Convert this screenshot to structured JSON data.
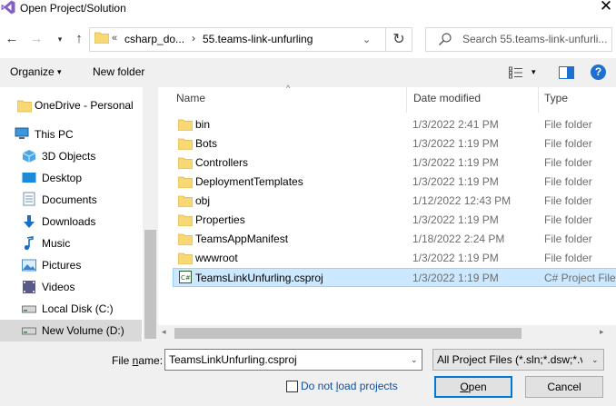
{
  "window": {
    "title": "Open Project/Solution",
    "close_glyph": "✕"
  },
  "nav": {
    "back_glyph": "←",
    "forward_glyph": "→",
    "recent_glyph": "▾",
    "up_glyph": "↑",
    "address": {
      "chevrons": "«",
      "segment1": "csharp_do...",
      "separator": "›",
      "segment2": "55.teams-link-unfurling",
      "dropdown_glyph": "⌄"
    },
    "refresh_glyph": "↻",
    "search_placeholder": "Search 55.teams-link-unfurli..."
  },
  "toolbar": {
    "organize_label": "Organize",
    "organize_caret": "▾",
    "new_folder_label": "New folder",
    "view_caret": "▾",
    "help_glyph": "?"
  },
  "sidebar": {
    "items": [
      {
        "label": "OneDrive - Personal",
        "icon": "folder-icon"
      },
      {
        "label": "This PC",
        "icon": "pc-icon"
      },
      {
        "label": "3D Objects",
        "icon": "cube-icon"
      },
      {
        "label": "Desktop",
        "icon": "desktop-icon"
      },
      {
        "label": "Documents",
        "icon": "documents-icon"
      },
      {
        "label": "Downloads",
        "icon": "download-icon"
      },
      {
        "label": "Music",
        "icon": "music-icon"
      },
      {
        "label": "Pictures",
        "icon": "pictures-icon"
      },
      {
        "label": "Videos",
        "icon": "videos-icon"
      },
      {
        "label": "Local Disk (C:)",
        "icon": "drive-icon"
      },
      {
        "label": "New Volume (D:)",
        "icon": "drive-icon"
      }
    ]
  },
  "filelist": {
    "columns": {
      "name": "Name",
      "date": "Date modified",
      "type": "Type"
    },
    "sort_glyph": "^",
    "rows": [
      {
        "name": "bin",
        "date": "1/3/2022 2:41 PM",
        "type": "File folder"
      },
      {
        "name": "Bots",
        "date": "1/3/2022 1:19 PM",
        "type": "File folder"
      },
      {
        "name": "Controllers",
        "date": "1/3/2022 1:19 PM",
        "type": "File folder"
      },
      {
        "name": "DeploymentTemplates",
        "date": "1/3/2022 1:19 PM",
        "type": "File folder"
      },
      {
        "name": "obj",
        "date": "1/12/2022 12:43 PM",
        "type": "File folder"
      },
      {
        "name": "Properties",
        "date": "1/3/2022 1:19 PM",
        "type": "File folder"
      },
      {
        "name": "TeamsAppManifest",
        "date": "1/18/2022 2:24 PM",
        "type": "File folder"
      },
      {
        "name": "wwwroot",
        "date": "1/3/2022 1:19 PM",
        "type": "File folder"
      },
      {
        "name": "TeamsLinkUnfurling.csproj",
        "date": "1/3/2022 1:19 PM",
        "type": "C# Project File"
      }
    ],
    "scroll_left_glyph": "◂",
    "scroll_right_glyph": "▸"
  },
  "bottom": {
    "file_name_label_pre": "File ",
    "file_name_label_u": "n",
    "file_name_label_post": "ame:",
    "file_name_value": "TeamsLinkUnfurling.csproj",
    "filter_value": "All Project Files (*.sln;*.dsw;*.vc",
    "caret_glyph": "⌄",
    "no_load_label_pre": "Do not ",
    "no_load_label_u": "l",
    "no_load_label_post": "oad projects",
    "open_label_u": "O",
    "open_label_post": "pen",
    "cancel_label": "Cancel"
  },
  "colors": {
    "selection": "#cce8ff",
    "accent": "#0078d7",
    "folder": "#f8d775"
  }
}
